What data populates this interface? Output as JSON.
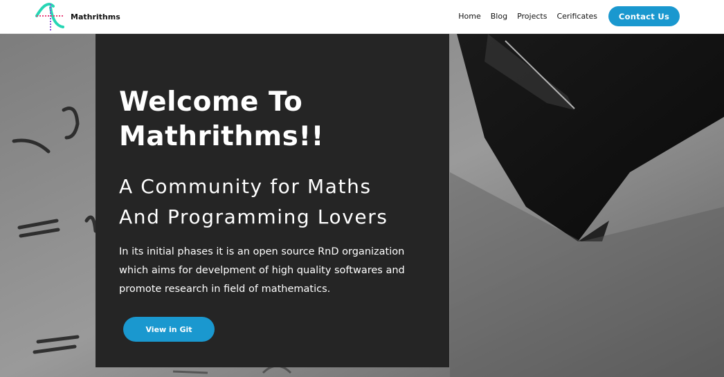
{
  "header": {
    "brand_name": "Mathrithms",
    "logo_icon": "mathrithms-logo-icon",
    "nav": [
      {
        "label": "Home"
      },
      {
        "label": "Blog"
      },
      {
        "label": "Projects"
      },
      {
        "label": "Cerificates"
      }
    ],
    "contact_label": "Contact Us"
  },
  "hero": {
    "title_line1": "Welcome To",
    "title_line2": "Mathrithms!!",
    "subtitle_line1": "A Community for Maths",
    "subtitle_line2": "And Programming Lovers",
    "description": "In its initial phases it is an open source RnD organization which aims for develpment of high quality softwares and promote research in field of mathematics.",
    "git_button_label": "View in Git",
    "background_image": "pen-writing-math-photo"
  },
  "colors": {
    "accent": "#1a98cf",
    "panel": "#252525",
    "logo_teal": "#26d6b4",
    "logo_purple": "#8a4fd8",
    "logo_pink": "#e8407a"
  }
}
